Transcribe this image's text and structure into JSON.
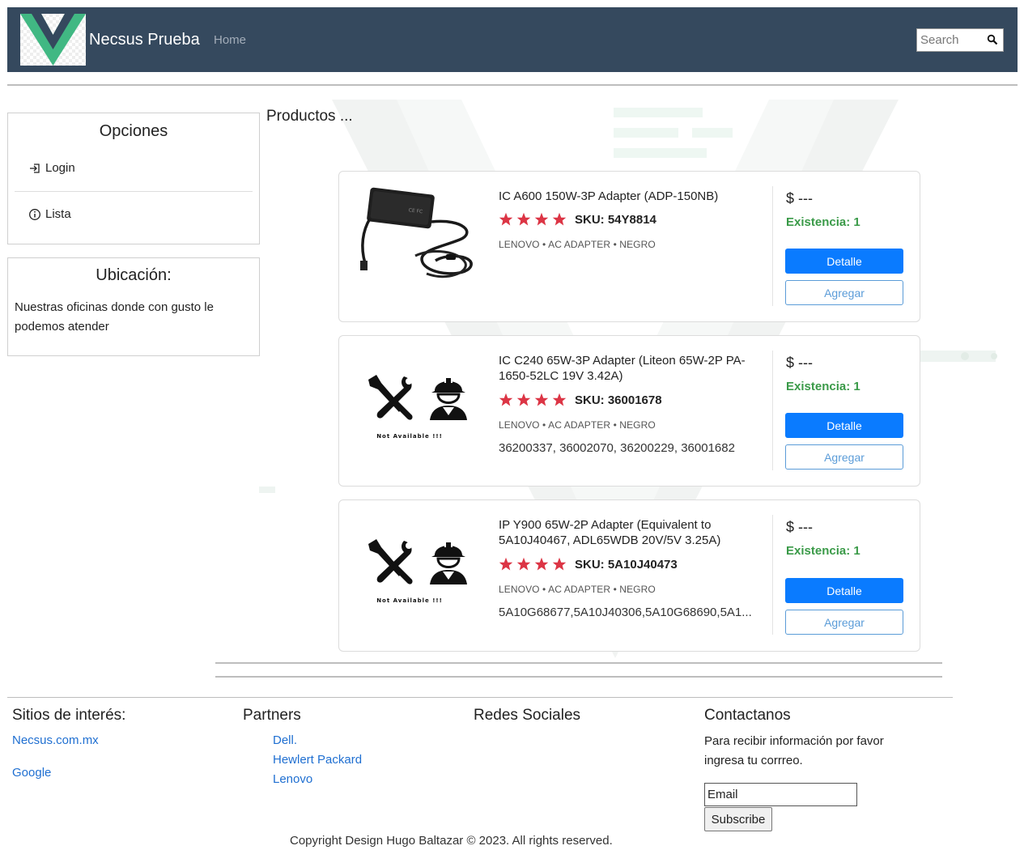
{
  "navbar": {
    "brand": "Necsus Prueba",
    "home_label": "Home",
    "search_placeholder": "Search"
  },
  "sidebar": {
    "opciones_title": "Opciones",
    "items": [
      {
        "label": "Login",
        "icon": "login-icon"
      },
      {
        "label": "Lista",
        "icon": "info-icon"
      }
    ],
    "ubicacion_title": "Ubicación:",
    "ubicacion_text": "Nuestras oficinas donde con gusto le podemos atender"
  },
  "main": {
    "title": "Productos ...",
    "products": [
      {
        "name": "IC A600 150W-3P Adapter (ADP-150NB)",
        "sku": "SKU: 54Y8814",
        "rating": 4,
        "meta": "LENOVO • AC ADAPTER • NEGRO",
        "codes": "",
        "image": "ac-adapter-photo",
        "price": "$ ---",
        "stock": "Existencia: 1",
        "detalle_label": "Detalle",
        "agregar_label": "Agregar"
      },
      {
        "name": "IC C240 65W-3P Adapter (Liteon 65W-2P PA-1650-52LC 19V 3.42A)",
        "sku": "SKU: 36001678",
        "rating": 4,
        "meta": "LENOVO • AC ADAPTER • NEGRO",
        "codes": "36200337, 36002070, 36200229, 36001682",
        "image": "not-available",
        "image_caption": "Not Available !!!",
        "price": "$ ---",
        "stock": "Existencia: 1",
        "detalle_label": "Detalle",
        "agregar_label": "Agregar"
      },
      {
        "name": "IP Y900 65W-2P Adapter (Equivalent to 5A10J40467, ADL65WDB 20V/5V 3.25A)",
        "sku": "SKU: 5A10J40473",
        "rating": 4,
        "meta": "LENOVO • AC ADAPTER • NEGRO",
        "codes": "5A10G68677,5A10J40306,5A10G68690,5A1...",
        "image": "not-available",
        "image_caption": "Not Available !!!",
        "price": "$ ---",
        "stock": "Existencia: 1",
        "detalle_label": "Detalle",
        "agregar_label": "Agregar"
      }
    ]
  },
  "footer": {
    "sitios_title": "Sitios de interés:",
    "sitios": [
      "Necsus.com.mx",
      "Google"
    ],
    "partners_title": "Partners",
    "partners": [
      "Dell.",
      "Hewlert Packard",
      "Lenovo"
    ],
    "redes_title": "Redes Sociales",
    "contact_title": "Contactanos",
    "contact_text": "Para recibir información por favor ingresa tu corrreo.",
    "email_placeholder": "Email",
    "subscribe_label": "Subscribe",
    "copyright": "Copyright Design Hugo Baltazar © 2023. All rights reserved."
  },
  "colors": {
    "navbar_bg": "#35495e",
    "primary": "#0a7bff",
    "star": "#dc3545",
    "stock": "#3a9a48",
    "link": "#1f6fd1",
    "vue_green": "#41b883"
  }
}
